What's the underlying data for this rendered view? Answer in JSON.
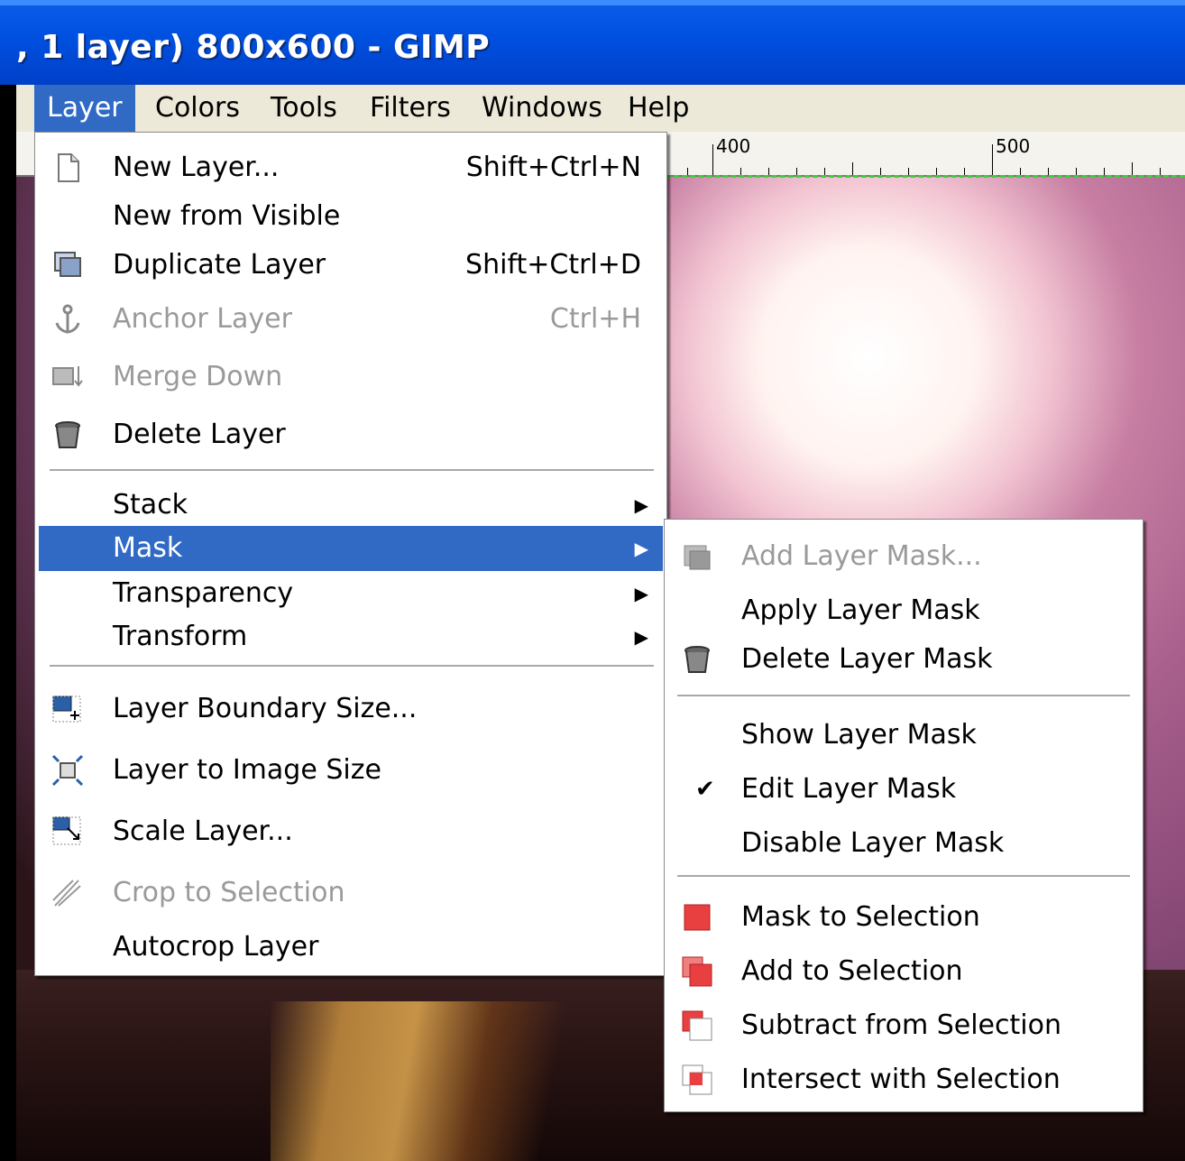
{
  "window": {
    "title": ", 1 layer) 800x600 - GIMP"
  },
  "menubar": [
    "Layer",
    "Colors",
    "Tools",
    "Filters",
    "Windows",
    "Help"
  ],
  "ruler": {
    "labels": [
      "400",
      "500"
    ]
  },
  "layer_menu": {
    "items": [
      {
        "label": "New Layer...",
        "shortcut": "Shift+Ctrl+N",
        "icon": "new-layer-icon",
        "disabled": false
      },
      {
        "label": "New from Visible",
        "shortcut": "",
        "icon": "",
        "disabled": false
      },
      {
        "label": "Duplicate Layer",
        "shortcut": "Shift+Ctrl+D",
        "icon": "duplicate-layer-icon",
        "disabled": false
      },
      {
        "label": "Anchor Layer",
        "shortcut": "Ctrl+H",
        "icon": "anchor-icon",
        "disabled": true
      },
      {
        "label": "Merge Down",
        "shortcut": "",
        "icon": "merge-down-icon",
        "disabled": true
      },
      {
        "label": "Delete Layer",
        "shortcut": "",
        "icon": "trash-icon",
        "disabled": false
      },
      {
        "label": "Stack",
        "submenu": true
      },
      {
        "label": "Mask",
        "submenu": true,
        "highlighted": true
      },
      {
        "label": "Transparency",
        "submenu": true
      },
      {
        "label": "Transform",
        "submenu": true
      },
      {
        "label": "Layer Boundary Size...",
        "icon": "layer-boundary-icon",
        "disabled": false
      },
      {
        "label": "Layer to Image Size",
        "icon": "layer-to-image-icon",
        "disabled": false
      },
      {
        "label": "Scale Layer...",
        "icon": "scale-layer-icon",
        "disabled": false
      },
      {
        "label": "Crop to Selection",
        "icon": "crop-icon",
        "disabled": true
      },
      {
        "label": "Autocrop Layer",
        "icon": "",
        "disabled": false
      }
    ]
  },
  "mask_menu": {
    "items": [
      {
        "label": "Add Layer Mask...",
        "icon": "add-mask-icon",
        "disabled": true
      },
      {
        "label": "Apply Layer Mask",
        "icon": "",
        "disabled": false
      },
      {
        "label": "Delete Layer Mask",
        "icon": "trash-icon",
        "disabled": false
      },
      {
        "label": "Show Layer Mask",
        "icon": "",
        "disabled": false
      },
      {
        "label": "Edit Layer Mask",
        "icon": "checkmark-icon",
        "checked": true,
        "disabled": false
      },
      {
        "label": "Disable Layer Mask",
        "icon": "",
        "disabled": false
      },
      {
        "label": "Mask to Selection",
        "icon": "mask-to-selection-icon",
        "disabled": false
      },
      {
        "label": "Add to Selection",
        "icon": "add-to-selection-icon",
        "disabled": false
      },
      {
        "label": "Subtract from Selection",
        "icon": "subtract-selection-icon",
        "disabled": false
      },
      {
        "label": "Intersect with Selection",
        "icon": "intersect-selection-icon",
        "disabled": false
      }
    ]
  },
  "submenu_arrow": "▶",
  "checkmark": "✔"
}
